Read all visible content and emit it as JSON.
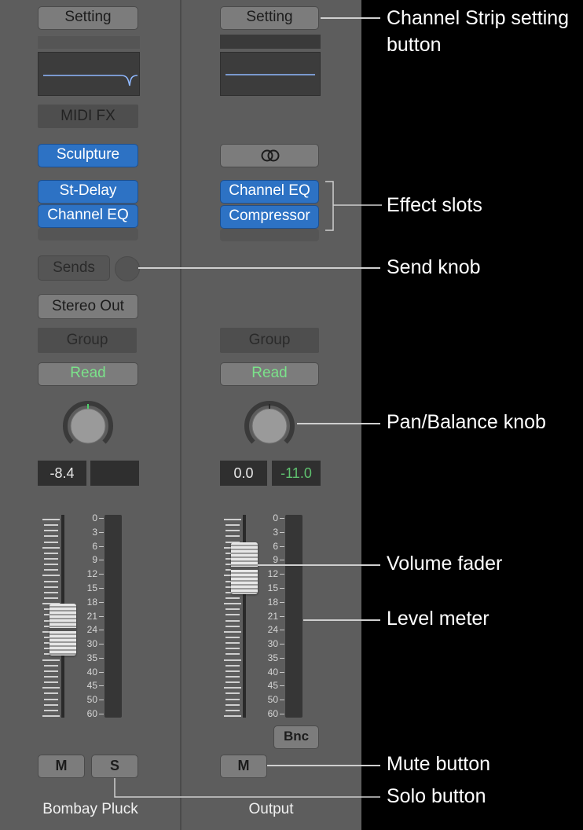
{
  "strip1": {
    "setting_label": "Setting",
    "midi_fx_label": "MIDI FX",
    "instrument_label": "Sculpture",
    "effects": [
      "St-Delay",
      "Channel EQ"
    ],
    "sends_label": "Sends",
    "output_label": "Stereo Out",
    "group_label": "Group",
    "automation_label": "Read",
    "volume_readout": "-8.4",
    "peak_readout": "",
    "mute_label": "M",
    "solo_label": "S",
    "name": "Bombay Pluck"
  },
  "strip2": {
    "setting_label": "Setting",
    "input_icon": "stereo-link-icon",
    "effects": [
      "Channel EQ",
      "Compressor"
    ],
    "group_label": "Group",
    "automation_label": "Read",
    "volume_readout": "0.0",
    "peak_readout": "-11.0",
    "bounce_label": "Bnc",
    "mute_label": "M",
    "name": "Output"
  },
  "meter_scale": [
    "0",
    "3",
    "6",
    "9",
    "12",
    "15",
    "18",
    "21",
    "24",
    "30",
    "35",
    "40",
    "45",
    "50",
    "60"
  ],
  "callouts": {
    "setting": "Channel Strip setting button",
    "effects": "Effect slots",
    "send": "Send knob",
    "pan": "Pan/Balance knob",
    "fader": "Volume fader",
    "meter": "Level meter",
    "mute": "Mute button",
    "solo": "Solo button"
  },
  "colors": {
    "plugin_blue": "#2d72c4",
    "read_green": "#7be28a",
    "peak_green": "#5fc16f",
    "eq_curve": "#8fb8ff"
  }
}
